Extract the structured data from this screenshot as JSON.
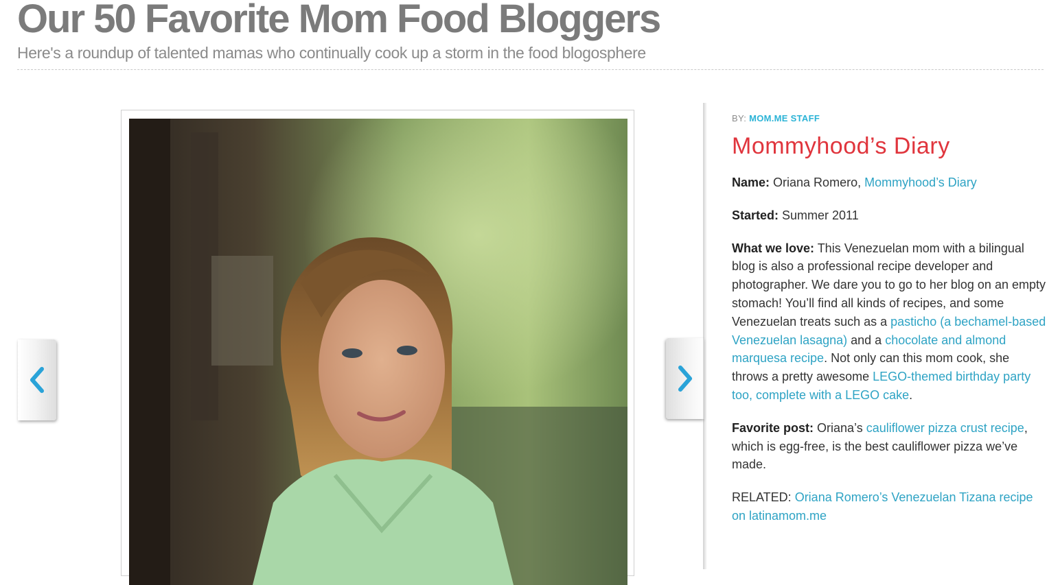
{
  "header": {
    "title": "Our 50 Favorite Mom Food Bloggers",
    "subtitle": "Here's a roundup of talented mamas who continually cook up a storm in the food blogosphere"
  },
  "slideshow": {
    "prev_icon": "chevron-left-icon",
    "next_icon": "chevron-right-icon",
    "arrow_color": "#2aa3d8"
  },
  "article": {
    "byline_prefix": "BY: ",
    "byline_author": "MOM.ME STAFF",
    "title": "Mommyhood’s Diary",
    "name_label": "Name:",
    "name_value": " Oriana Romero, ",
    "name_link": "Mommyhood’s Diary",
    "started_label": "Started:",
    "started_value": " Summer 2011",
    "love_label": "What we love:",
    "love_text_1": " This Venezuelan mom with a bilingual blog is also a professional recipe developer and photographer. We dare you to go to her blog on an empty stomach! You’ll find all kinds of recipes, and some Venezuelan treats such as a ",
    "love_link_1": "pasticho (a bechamel-based Venezuelan lasagna)",
    "love_text_2": " and a ",
    "love_link_2": "chocolate and almond marquesa recipe",
    "love_text_3": ". Not only can this mom cook, she throws a pretty awesome ",
    "love_link_3": "LEGO-themed birthday party too, complete with a LEGO cake",
    "love_text_4": ".",
    "fav_label": "Favorite post:",
    "fav_text_1": " Oriana’s ",
    "fav_link": "cauliflower pizza crust recipe",
    "fav_text_2": ", which is egg-free, is the best cauliflower pizza we’ve made.",
    "related_label": "RELATED: ",
    "related_link": "Oriana Romero’s Venezuelan Tizana recipe on latinamom.me"
  },
  "colors": {
    "title_gray": "#7b7b7b",
    "blog_title_red": "#e0353d",
    "link_blue": "#2ea3c4",
    "byline_blue": "#2bb3d6"
  }
}
